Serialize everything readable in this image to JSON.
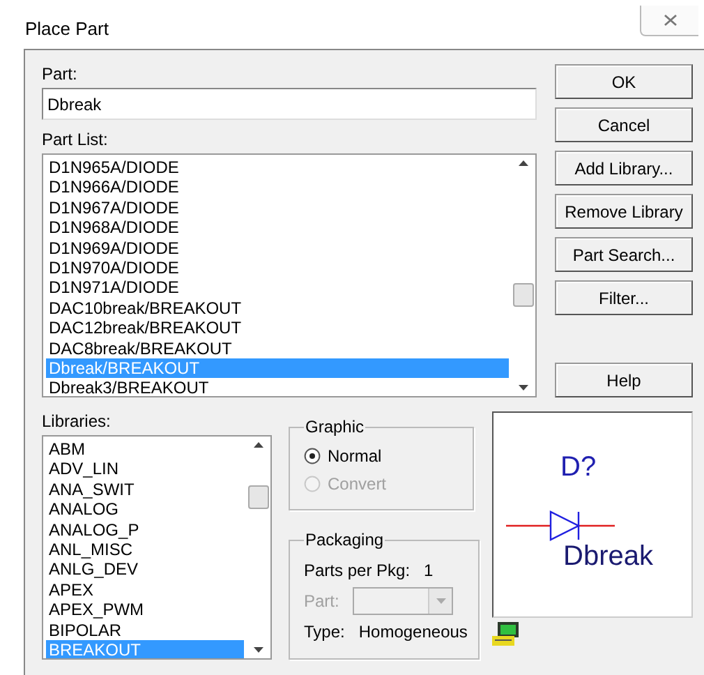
{
  "window": {
    "title": "Place Part"
  },
  "part": {
    "label": "Part:",
    "value": "Dbreak"
  },
  "part_list": {
    "label": "Part List:",
    "items": [
      {
        "text": "D1N965A/DIODE",
        "selected": false
      },
      {
        "text": "D1N966A/DIODE",
        "selected": false
      },
      {
        "text": "D1N967A/DIODE",
        "selected": false
      },
      {
        "text": "D1N968A/DIODE",
        "selected": false
      },
      {
        "text": "D1N969A/DIODE",
        "selected": false
      },
      {
        "text": "D1N970A/DIODE",
        "selected": false
      },
      {
        "text": "D1N971A/DIODE",
        "selected": false
      },
      {
        "text": "DAC10break/BREAKOUT",
        "selected": false
      },
      {
        "text": "DAC12break/BREAKOUT",
        "selected": false
      },
      {
        "text": "DAC8break/BREAKOUT",
        "selected": false
      },
      {
        "text": "Dbreak/BREAKOUT",
        "selected": true
      },
      {
        "text": "Dbreak3/BREAKOUT",
        "selected": false
      }
    ]
  },
  "buttons": [
    {
      "label": "OK"
    },
    {
      "label": "Cancel"
    },
    {
      "label": "Add Library..."
    },
    {
      "label": "Remove Library"
    },
    {
      "label": "Part Search..."
    },
    {
      "label": "Filter..."
    }
  ],
  "help_button": {
    "label": "Help"
  },
  "libraries": {
    "label": "Libraries:",
    "items": [
      {
        "text": "ABM",
        "selected": false
      },
      {
        "text": "ADV_LIN",
        "selected": false
      },
      {
        "text": "ANA_SWIT",
        "selected": false
      },
      {
        "text": "ANALOG",
        "selected": false
      },
      {
        "text": "ANALOG_P",
        "selected": false
      },
      {
        "text": "ANL_MISC",
        "selected": false
      },
      {
        "text": "ANLG_DEV",
        "selected": false
      },
      {
        "text": "APEX",
        "selected": false
      },
      {
        "text": "APEX_PWM",
        "selected": false
      },
      {
        "text": "BIPOLAR",
        "selected": false
      },
      {
        "text": "BREAKOUT",
        "selected": true
      }
    ]
  },
  "graphic": {
    "title": "Graphic",
    "options": [
      {
        "label": "Normal",
        "selected": true,
        "disabled": false
      },
      {
        "label": "Convert",
        "selected": false,
        "disabled": true
      }
    ]
  },
  "packaging": {
    "title": "Packaging",
    "parts_per_pkg_label": "Parts per Pkg:",
    "parts_per_pkg": "1",
    "part": {
      "label": "Part:",
      "disabled": true
    },
    "type_label": "Type:",
    "type": "Homogeneous"
  },
  "preview": {
    "reference": "D?",
    "name": "Dbreak"
  }
}
